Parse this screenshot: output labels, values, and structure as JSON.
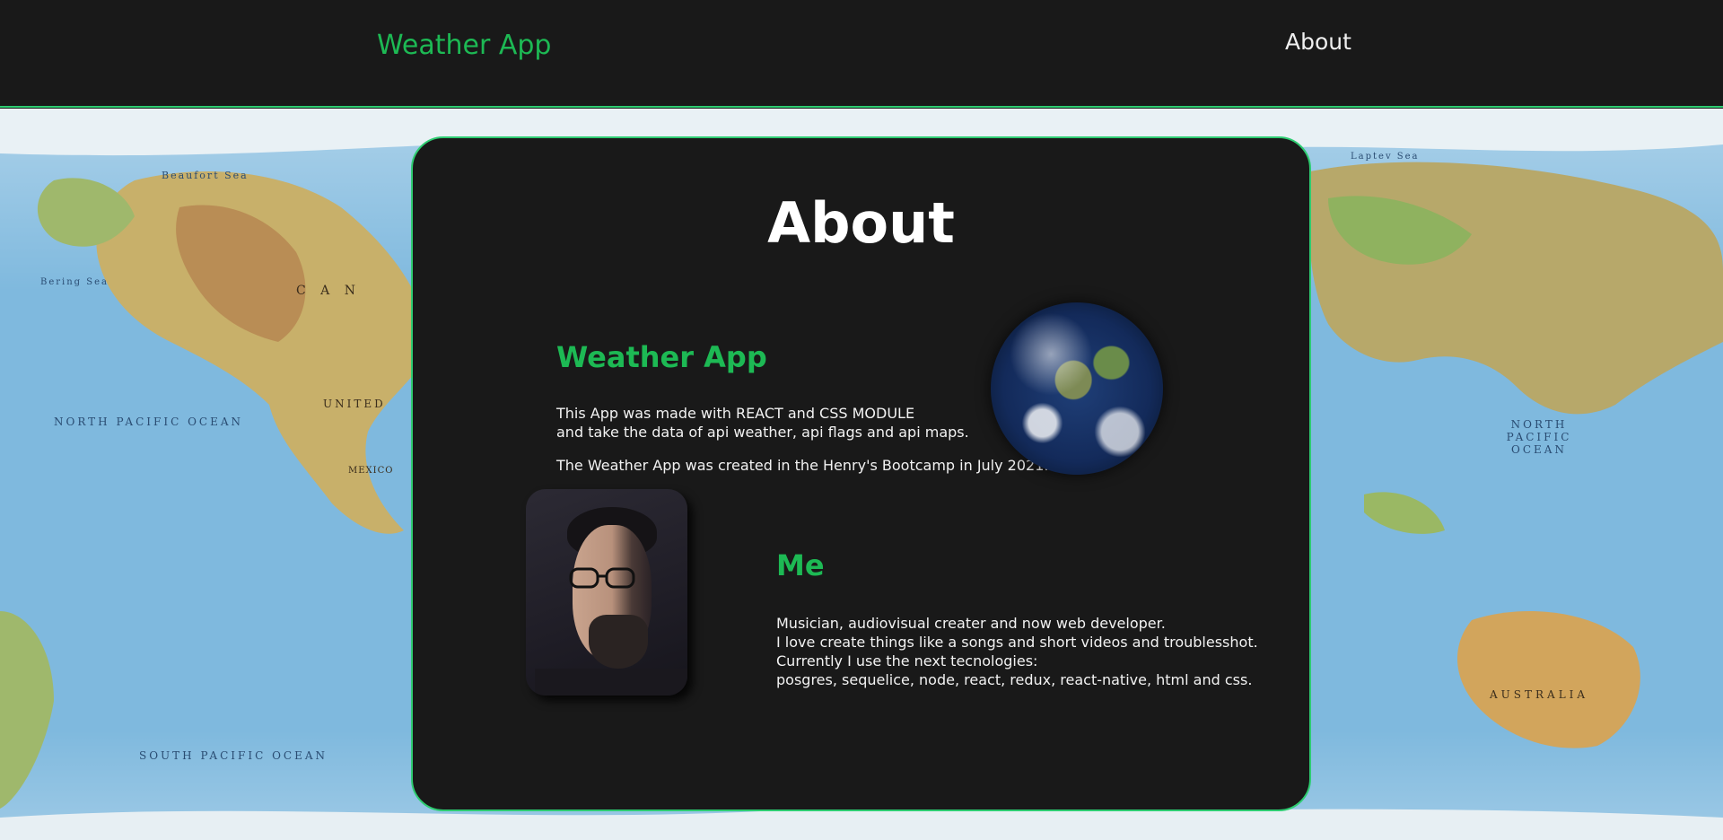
{
  "navbar": {
    "brand": "Weather App",
    "about_link": "About"
  },
  "map": {
    "labels": {
      "beaufort_sea": "Beaufort Sea",
      "north_pacific": "NORTH PACIFIC OCEAN",
      "south_pacific": "SOUTH PACIFIC OCEAN",
      "north_pacific_right": "NORTH PACIFIC OCEAN",
      "canada": "C A N",
      "united": "UNITED",
      "australia": "AUSTRALIA",
      "laptev_sea": "Laptev Sea",
      "bering_sea": "Bering Sea",
      "mexico": "MEXICO"
    }
  },
  "card": {
    "title": "About",
    "app_section": {
      "title": "Weather App",
      "line1": "This App was made with REACT and CSS MODULE",
      "line2": "and take the data of api weather, api flags and api maps.",
      "line3": "The Weather App was created in the Henry's Bootcamp in July 2021."
    },
    "me_section": {
      "title": "Me",
      "line1": "Musician, audiovisual creater and now web developer.",
      "line2": "I love create things like a songs and short videos and troublesshot.",
      "line3": "Currently I use the next tecnologies:",
      "line4": "posgres, sequelice, node, react, redux, react-native, html and css."
    }
  },
  "colors": {
    "accent": "#1db954",
    "border": "#2ecc71",
    "card_bg": "#191919"
  }
}
